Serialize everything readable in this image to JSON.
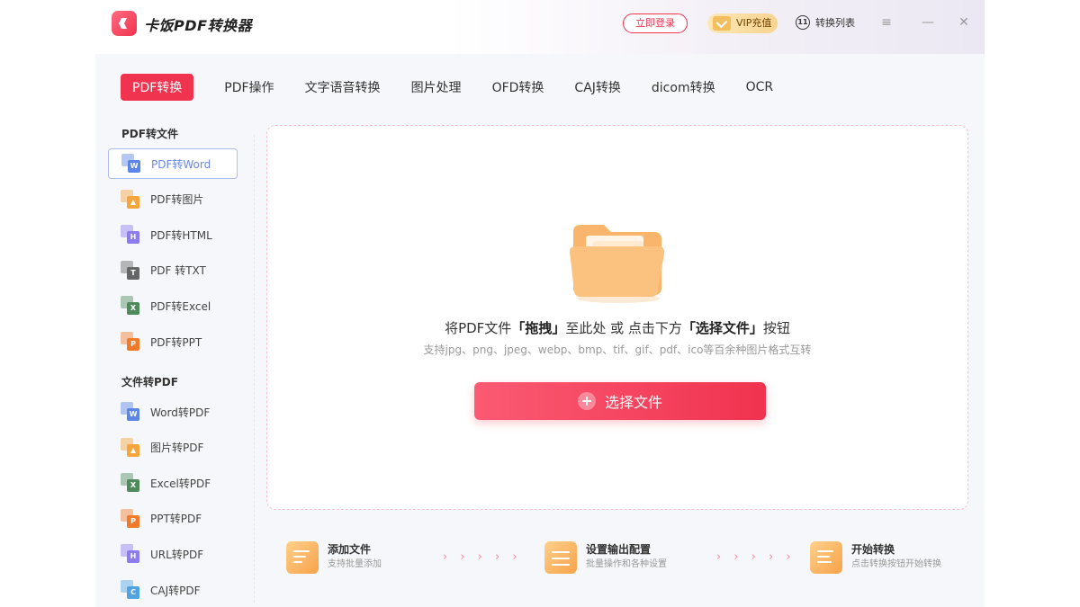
{
  "app": {
    "title": "卡饭PDF转换器"
  },
  "header": {
    "login_label": "立即登录",
    "vip_label": "VIP充值",
    "convert_list_label": "转换列表",
    "clock_glyph": "11"
  },
  "tabs": [
    {
      "label": "PDF转换",
      "active": true
    },
    {
      "label": "PDF操作"
    },
    {
      "label": "文字语音转换"
    },
    {
      "label": "图片处理"
    },
    {
      "label": "OFD转换"
    },
    {
      "label": "CAJ转换"
    },
    {
      "label": "dicom转换"
    },
    {
      "label": "OCR"
    }
  ],
  "sidebar": {
    "group1_title": "PDF转文件",
    "group1_items": [
      {
        "label": "PDF转Word",
        "icon": "word-icon",
        "tag": "W",
        "color": "#5b86e5",
        "active": true
      },
      {
        "label": "PDF转图片",
        "icon": "image-icon",
        "tag": "▲",
        "color": "#f5a53c"
      },
      {
        "label": "PDF转HTML",
        "icon": "html-icon",
        "tag": "H",
        "color": "#8b7cf0"
      },
      {
        "label": "PDF 转TXT",
        "icon": "txt-icon",
        "tag": "T",
        "color": "#666666"
      },
      {
        "label": "PDF转Excel",
        "icon": "excel-icon",
        "tag": "X",
        "color": "#4f8a5c"
      },
      {
        "label": "PDF转PPT",
        "icon": "ppt-icon",
        "tag": "P",
        "color": "#f07a2a"
      }
    ],
    "group2_title": "文件转PDF",
    "group2_items": [
      {
        "label": "Word转PDF",
        "icon": "word-icon",
        "tag": "W",
        "color": "#5b86e5"
      },
      {
        "label": "图片转PDF",
        "icon": "image-icon",
        "tag": "▲",
        "color": "#f5a53c"
      },
      {
        "label": "Excel转PDF",
        "icon": "excel-icon",
        "tag": "X",
        "color": "#4f8a5c"
      },
      {
        "label": "PPT转PDF",
        "icon": "ppt-icon",
        "tag": "P",
        "color": "#f07a2a"
      },
      {
        "label": "URL转PDF",
        "icon": "url-icon",
        "tag": "H",
        "color": "#8b7cf0"
      },
      {
        "label": "CAJ转PDF",
        "icon": "caj-icon",
        "tag": "C",
        "color": "#4fa3e0"
      }
    ]
  },
  "dropzone": {
    "text_prefix": "将PDF文件",
    "text_drag": "「拖拽」",
    "text_middle": "至此处 或 点击下方",
    "text_choose": "「选择文件」",
    "text_suffix": "按钮",
    "hint": "支持jpg、png、jpeg、webp、bmp、tif、gif、pdf、ico等百余种图片格式互转",
    "button_label": "选择文件"
  },
  "steps": [
    {
      "title": "添加文件",
      "subtitle": "支持批量添加"
    },
    {
      "title": "设置输出配置",
      "subtitle": "批量操作和各种设置"
    },
    {
      "title": "开始转换",
      "subtitle": "点击转换按钮开始转换"
    }
  ],
  "arrows": "› › › › ›",
  "colors": {
    "accent": "#f0334f",
    "active_sidebar": "#6a86e6",
    "step_icon": "#f7a24a"
  }
}
